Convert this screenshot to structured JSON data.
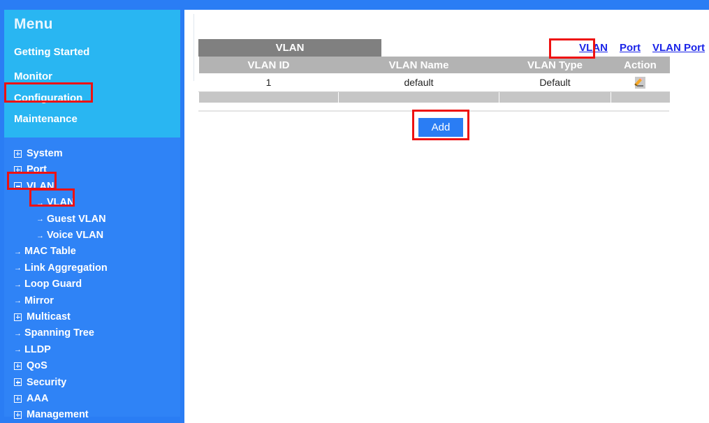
{
  "sidebar": {
    "title": "Menu",
    "menu_links": [
      {
        "label": "Getting Started",
        "highlighted": false
      },
      {
        "label": "Monitor",
        "highlighted": false
      },
      {
        "label": "Configuration",
        "highlighted": true
      },
      {
        "label": "Maintenance",
        "highlighted": false
      }
    ],
    "tree": [
      {
        "label": "System",
        "marker": "plus",
        "indent": 0,
        "highlighted": false
      },
      {
        "label": "Port",
        "marker": "plus",
        "indent": 0,
        "highlighted": false
      },
      {
        "label": "VLAN",
        "marker": "minus",
        "indent": 0,
        "highlighted": true
      },
      {
        "label": "VLAN",
        "marker": "bullet",
        "indent": 1,
        "highlighted": true
      },
      {
        "label": "Guest VLAN",
        "marker": "bullet",
        "indent": 1,
        "highlighted": false
      },
      {
        "label": "Voice VLAN",
        "marker": "bullet",
        "indent": 1,
        "highlighted": false
      },
      {
        "label": "MAC Table",
        "marker": "bullet",
        "indent": 0,
        "highlighted": false
      },
      {
        "label": "Link Aggregation",
        "marker": "bullet",
        "indent": 0,
        "highlighted": false
      },
      {
        "label": "Loop Guard",
        "marker": "bullet",
        "indent": 0,
        "highlighted": false
      },
      {
        "label": "Mirror",
        "marker": "bullet",
        "indent": 0,
        "highlighted": false
      },
      {
        "label": "Multicast",
        "marker": "plus",
        "indent": 0,
        "highlighted": false
      },
      {
        "label": "Spanning Tree",
        "marker": "bullet",
        "indent": 0,
        "highlighted": false
      },
      {
        "label": "LLDP",
        "marker": "bullet",
        "indent": 0,
        "highlighted": false
      },
      {
        "label": "QoS",
        "marker": "plus",
        "indent": 0,
        "highlighted": false
      },
      {
        "label": "Security",
        "marker": "plus",
        "indent": 0,
        "highlighted": false
      },
      {
        "label": "AAA",
        "marker": "plus",
        "indent": 0,
        "highlighted": false
      },
      {
        "label": "Management",
        "marker": "plus",
        "indent": 0,
        "highlighted": false
      }
    ]
  },
  "main": {
    "caption": "VLAN",
    "tabs": [
      {
        "label": "VLAN",
        "active": true
      },
      {
        "label": "Port",
        "active": false
      },
      {
        "label": "VLAN Port",
        "active": false
      }
    ],
    "table": {
      "headers": [
        "VLAN ID",
        "VLAN Name",
        "VLAN Type",
        "Action"
      ],
      "rows": [
        {
          "vlan_id": "1",
          "vlan_name": "default",
          "vlan_type": "Default",
          "action_icon": "edit-pencil-icon"
        }
      ]
    },
    "add_button": "Add"
  },
  "colors": {
    "header_band": "#2a7df4",
    "menu_panel": "#29b6f2",
    "tree_panel": "#2f83f6",
    "caption_bar": "#808080",
    "table_header": "#b3b3b3",
    "table_filler": "#c6c6c6",
    "link": "#1a24e8",
    "annotation": "#ee1111",
    "button": "#2a7df4"
  }
}
